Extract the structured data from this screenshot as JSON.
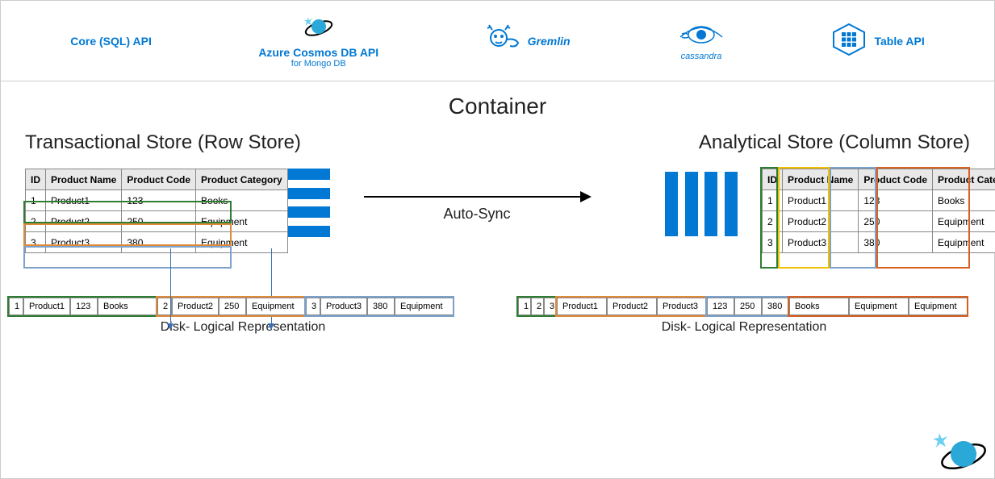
{
  "apis": {
    "core": "Core (SQL) API",
    "cosmos_line1": "Azure Cosmos DB API",
    "cosmos_line2": "for Mongo DB",
    "gremlin": "Gremlin",
    "cassandra": "cassandra",
    "table": "Table API"
  },
  "container_title": "Container",
  "left": {
    "title": "Transactional Store (Row Store)",
    "disk_label": "Disk- Logical Representation"
  },
  "right": {
    "title": "Analytical Store (Column Store)",
    "disk_label": "Disk- Logical Representation"
  },
  "arrow_label": "Auto-Sync",
  "table": {
    "headers": [
      "ID",
      "Product Name",
      "Product Code",
      "Product Category"
    ],
    "rows": [
      [
        "1",
        "Product1",
        "123",
        "Books"
      ],
      [
        "2",
        "Product2",
        "250",
        "Equipment"
      ],
      [
        "3",
        "Product3",
        "380",
        "Equipment"
      ]
    ]
  },
  "colors": {
    "green": "#2e7d32",
    "orange": "#e08b3a",
    "blue": "#7ba2cc",
    "yellow": "#f0c000",
    "darkorange": "#d86020"
  }
}
